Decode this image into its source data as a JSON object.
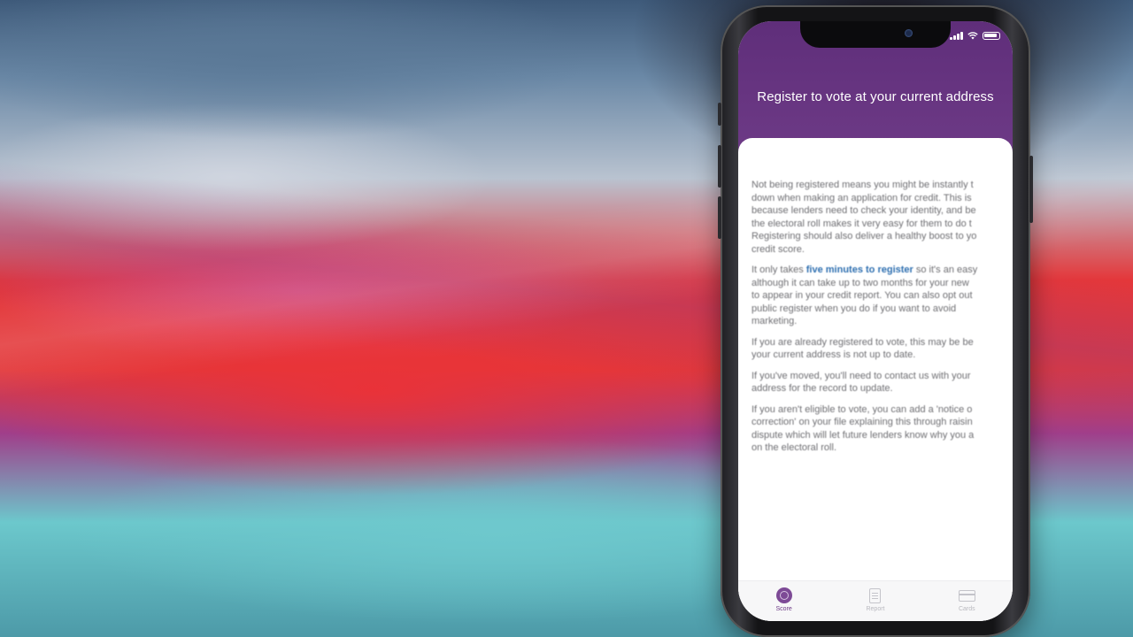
{
  "screen": {
    "title": "Register to vote at your current address"
  },
  "content": {
    "paragraph1": [
      "Not being registered means you might be instantly t",
      "down when making an application for credit. This is",
      "because lenders need to check your identity, and be",
      "the electoral roll makes it very easy for them to do t",
      "Registering should also deliver a healthy boost to yo",
      "credit score."
    ],
    "paragraph2": {
      "before_link": "It only takes ",
      "link_text": "five minutes to register",
      "after_link": " so it's an easy",
      "lines": [
        "although it can take up to two months for your new",
        "to appear in your credit report. You can also opt out",
        "public register when you do if you want to avoid",
        "marketing."
      ]
    },
    "paragraph3": [
      "If you are already registered to vote, this may be be",
      "your current address is not up to date."
    ],
    "paragraph4": [
      "If you've moved, you'll need to contact us with your",
      "address for the record to update."
    ],
    "paragraph5": [
      "If you aren't eligible to vote, you can add a 'notice o",
      "correction' on your file explaining this through raisin",
      "dispute which will let future lenders know why you a",
      "on the electoral roll."
    ]
  },
  "tabbar": {
    "tabs": [
      {
        "label": "Score",
        "icon": "score-icon",
        "active": true
      },
      {
        "label": "Report",
        "icon": "report-icon",
        "active": false
      },
      {
        "label": "Cards",
        "icon": "cards-icon",
        "active": false
      }
    ]
  },
  "colors": {
    "header_purple": "#6d3a86",
    "link_blue": "#2e6fb0",
    "body_text": "#6f6f73"
  }
}
